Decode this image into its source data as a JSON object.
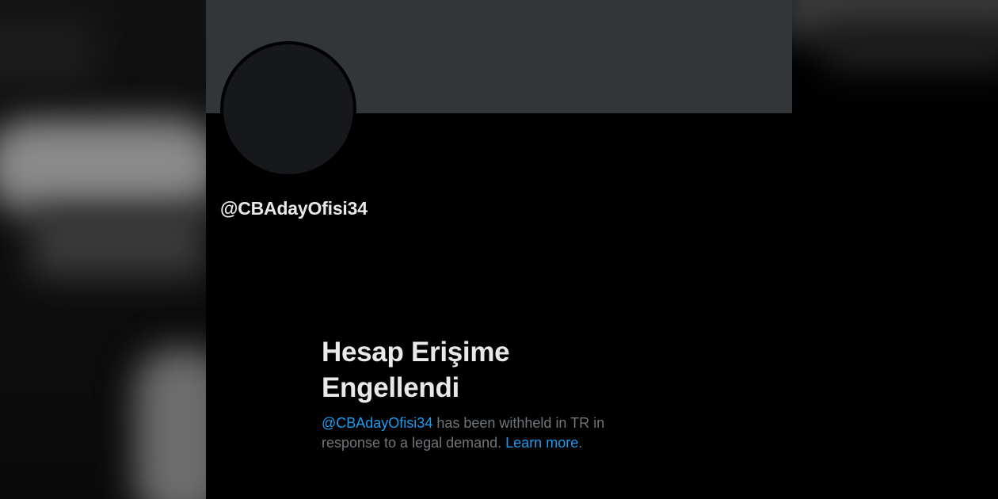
{
  "profile": {
    "handle": "@CBAdayOfisi34"
  },
  "withheld_notice": {
    "title_line1": "Hesap Erişime",
    "title_line2": "Engellendi",
    "body_handle": "@CBAdayOfisi34",
    "body_text_1": " has been withheld in TR in",
    "body_text_2": "response to a legal demand. ",
    "learn_more": "Learn more",
    "period": "."
  },
  "colors": {
    "background": "#000000",
    "banner": "#333639",
    "avatar": "#16181c",
    "primary_text": "#e7e9ea",
    "secondary_text": "#71767b",
    "link": "#1d9bf0"
  }
}
